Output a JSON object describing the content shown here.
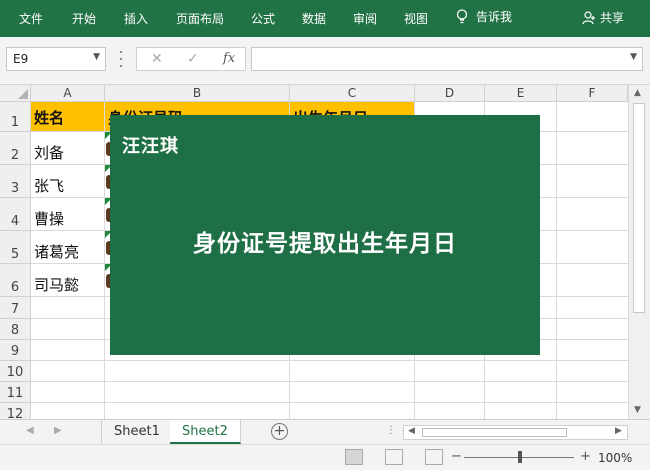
{
  "ribbon": {
    "tabs": [
      "文件",
      "开始",
      "插入",
      "页面布局",
      "公式",
      "数据",
      "审阅",
      "视图"
    ],
    "tell_me": "告诉我",
    "share": "共享",
    "bg_color": "#217346"
  },
  "formula_bar": {
    "name_box": "E9",
    "formula": "",
    "fx_label": "fx"
  },
  "grid": {
    "columns": [
      "A",
      "B",
      "C",
      "D",
      "E",
      "F"
    ],
    "rows": [
      "1",
      "2",
      "3",
      "4",
      "5",
      "6",
      "7",
      "8",
      "9",
      "10",
      "11",
      "12"
    ],
    "header_row": [
      "姓名",
      "身份证号码",
      "出生年月日"
    ],
    "names": [
      "刘备",
      "张飞",
      "曹操",
      "诸葛亮",
      "司马懿"
    ],
    "header_fill": "#ffc000"
  },
  "overlay": {
    "author": "汪汪琪",
    "headline": "身份证号提取出生年月日",
    "bg_color": "#1e6e46"
  },
  "sheets": {
    "tabs": [
      "Sheet1",
      "Sheet2"
    ],
    "active": "Sheet2"
  },
  "status": {
    "zoom_minus": "−",
    "zoom_plus": "+",
    "zoom": "100%"
  }
}
